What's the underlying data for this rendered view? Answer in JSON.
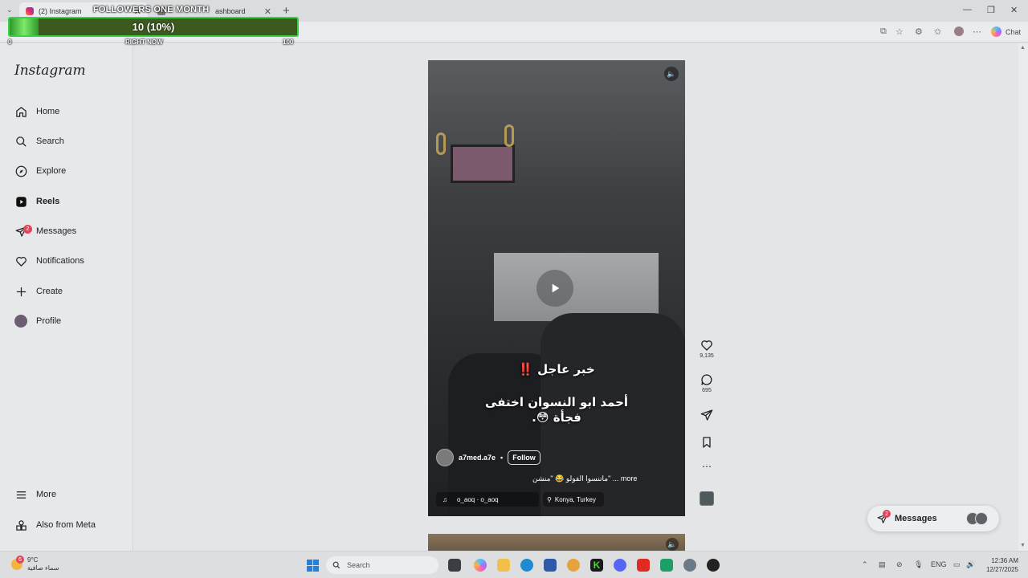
{
  "browser": {
    "tabs": [
      {
        "label": "(2) Instagram"
      },
      {
        "label": "ashboard"
      }
    ],
    "chat_label": "Chat"
  },
  "overlay": {
    "title": "FOLLOWERS ONE MONTH",
    "value": "10 (10%)",
    "progress_fraction": 0.1,
    "min_label": "0",
    "current_label": "RIGHT NOW",
    "max_label": "100"
  },
  "sidebar": {
    "logo": "Instagram",
    "items": [
      {
        "label": "Home",
        "icon": "home-icon"
      },
      {
        "label": "Search",
        "icon": "search-icon"
      },
      {
        "label": "Explore",
        "icon": "compass-icon"
      },
      {
        "label": "Reels",
        "icon": "reels-icon"
      },
      {
        "label": "Messages",
        "icon": "messenger-icon",
        "badge": "2"
      },
      {
        "label": "Notifications",
        "icon": "heart-icon"
      },
      {
        "label": "Create",
        "icon": "plus-icon"
      },
      {
        "label": "Profile",
        "icon": "profile-picture"
      }
    ],
    "bottom": [
      {
        "label": "More",
        "icon": "menu-icon"
      },
      {
        "label": "Also from Meta",
        "icon": "meta-apps-icon"
      }
    ]
  },
  "reel": {
    "headline": "خبر عاجل ‼️",
    "body_line1": "أحمد ابو النسوان اختفى",
    "body_line2": "فجأة 😳.",
    "author": "a7med.a7e",
    "follow_label": "Follow",
    "caption": "ماتنسوا الفولو 😂 \"منشن\" ... more",
    "audio": "o_aoq · o_aoq",
    "location": "Konya, Turkey"
  },
  "actions": {
    "likes": "9,135",
    "comments": "695"
  },
  "messages_pill": {
    "label": "Messages",
    "badge": "2"
  },
  "taskbar": {
    "temperature": "9°C",
    "weather_desc": "سماء صافية",
    "weather_badge": "6",
    "search_placeholder": "Search",
    "language": "ENG",
    "time": "12:36 AM",
    "date": "12/27/2025"
  },
  "colors": {
    "overlay_border": "#3fd04a",
    "badge_red": "#e0455a",
    "reel_bg": "#2f3032"
  }
}
